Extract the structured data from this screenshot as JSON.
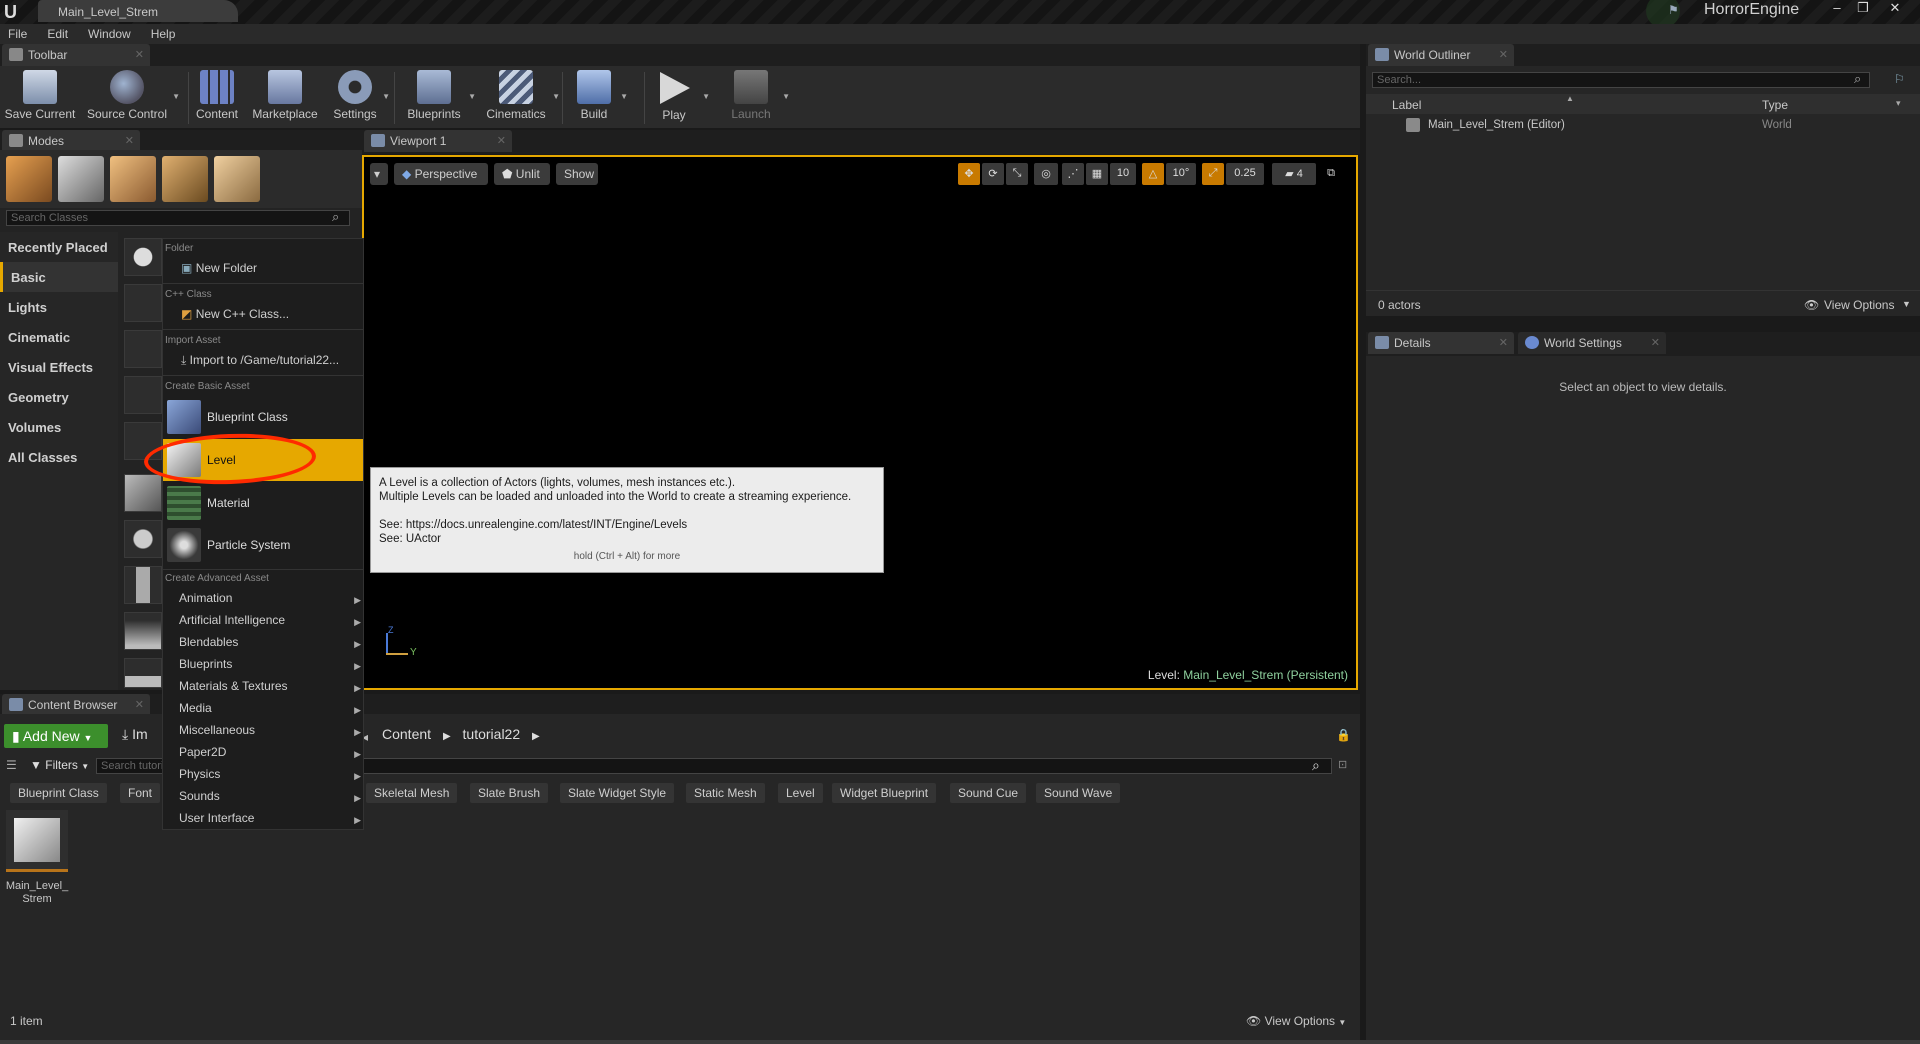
{
  "window": {
    "doc_tab": "Main_Level_Strem",
    "brand": "HorrorEngine",
    "controls": [
      "–",
      "❐",
      "✕"
    ]
  },
  "menu": [
    "File",
    "Edit",
    "Window",
    "Help"
  ],
  "toolbar": {
    "tab": "Toolbar",
    "buttons": [
      {
        "label": "Save Current",
        "icon": "save-icon"
      },
      {
        "label": "Source Control",
        "icon": "source-control-icon"
      },
      {
        "label": "Content",
        "icon": "content-icon"
      },
      {
        "label": "Marketplace",
        "icon": "marketplace-icon"
      },
      {
        "label": "Settings",
        "icon": "settings-icon"
      },
      {
        "label": "Blueprints",
        "icon": "blueprints-icon"
      },
      {
        "label": "Cinematics",
        "icon": "cinematics-icon"
      },
      {
        "label": "Build",
        "icon": "build-icon"
      },
      {
        "label": "Play",
        "icon": "play-icon"
      },
      {
        "label": "Launch",
        "icon": "launch-icon"
      }
    ]
  },
  "modes": {
    "tab": "Modes",
    "search_placeholder": "Search Classes",
    "categories": [
      "Recently Placed",
      "Basic",
      "Lights",
      "Cinematic",
      "Visual Effects",
      "Geometry",
      "Volumes",
      "All Classes"
    ],
    "active_category": "Basic"
  },
  "context_menu": {
    "folder_header": "Folder",
    "new_folder": "New Folder",
    "cpp_header": "C++ Class",
    "new_cpp": "New C++ Class...",
    "import_header": "Import Asset",
    "import_item": "Import to /Game/tutorial22...",
    "basic_header": "Create Basic Asset",
    "basic_items": [
      "Blueprint Class",
      "Level",
      "Material",
      "Particle System"
    ],
    "highlighted": "Level",
    "advanced_header": "Create Advanced Asset",
    "advanced_items": [
      "Animation",
      "Artificial Intelligence",
      "Blendables",
      "Blueprints",
      "Materials & Textures",
      "Media",
      "Miscellaneous",
      "Paper2D",
      "Physics",
      "Sounds",
      "User Interface"
    ]
  },
  "tooltip": {
    "line1": "A Level is a collection of Actors (lights, volumes, mesh instances etc.).",
    "line2": "Multiple Levels can be loaded and unloaded into the World to create a streaming experience.",
    "see1": "See: https://docs.unrealengine.com/latest/INT/Engine/Levels",
    "see2": "See: UActor",
    "hint": "hold (Ctrl + Alt) for more"
  },
  "viewport": {
    "tab": "Viewport 1",
    "perspective": "Perspective",
    "unlit": "Unlit",
    "show": "Show",
    "grid_snap": "10",
    "rot_snap": "10°",
    "scale_snap": "0.25",
    "cam_speed": "4",
    "level_label": "Level:",
    "level_name": "Main_Level_Strem (Persistent)",
    "axis_z": "Z",
    "axis_y": "Y"
  },
  "outliner": {
    "tab": "World Outliner",
    "search_placeholder": "Search...",
    "col_label": "Label",
    "col_type": "Type",
    "rows": [
      {
        "label": "Main_Level_Strem (Editor)",
        "type": "World"
      }
    ],
    "count": "0 actors",
    "view_options": "View Options"
  },
  "details": {
    "tab_details": "Details",
    "tab_world_settings": "World Settings",
    "empty_msg": "Select an object to view details."
  },
  "content_browser": {
    "tab": "Content Browser",
    "add_new": "Add New",
    "import": "Im",
    "filters": "Filters",
    "search_placeholder": "Search tutorial22",
    "path": [
      "Content",
      "tutorial22"
    ],
    "filter_chips": [
      "Blueprint Class",
      "Font",
      "Skeletal Mesh",
      "Slate Brush",
      "Slate Widget Style",
      "Static Mesh",
      "Level",
      "Widget Blueprint",
      "Sound Cue",
      "Sound Wave"
    ],
    "asset": {
      "name_line1": "Main_Level_",
      "name_line2": "Strem"
    },
    "count": "1 item",
    "view_options": "View Options"
  },
  "colors": {
    "accent": "#e6a800",
    "highlight_circle": "#ff2a00",
    "add_new_green": "#3c8f2c",
    "level_link": "#8fd19e"
  }
}
